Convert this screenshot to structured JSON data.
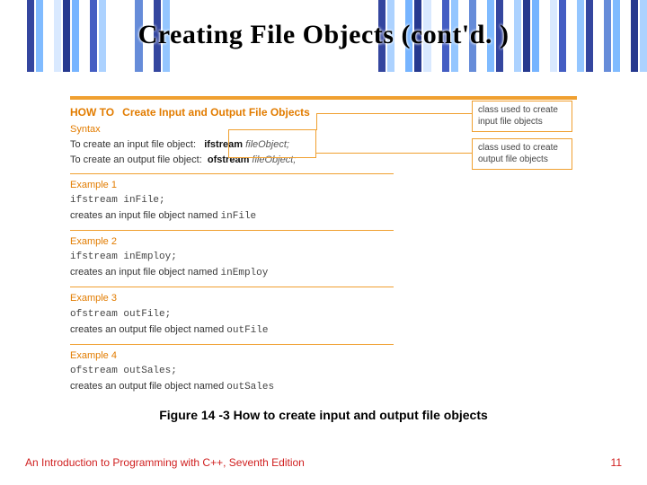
{
  "title": "Creating File Objects (cont'd. )",
  "howto": {
    "label": "HOW TO",
    "subject": "Create Input and Output File Objects",
    "syntax_label": "Syntax",
    "syntax_lines": {
      "in_prefix": "To create an input file object:",
      "in_kw": "ifstream",
      "in_obj": "fileObject;",
      "out_prefix": "To create an output file object:",
      "out_kw": "ofstream",
      "out_obj": "fileObject;"
    },
    "callouts": {
      "input": "class used to create input file objects",
      "output": "class used to create output file objects"
    },
    "examples": [
      {
        "label": "Example 1",
        "code": "ifstream inFile;",
        "desc_pre": "creates an input file object named ",
        "desc_obj": "inFile"
      },
      {
        "label": "Example 2",
        "code": "ifstream inEmploy;",
        "desc_pre": "creates an input file object named ",
        "desc_obj": "inEmploy"
      },
      {
        "label": "Example 3",
        "code": "ofstream outFile;",
        "desc_pre": "creates an output file object named ",
        "desc_obj": "outFile"
      },
      {
        "label": "Example 4",
        "code": "ofstream outSales;",
        "desc_pre": "creates an output file object named ",
        "desc_obj": "outSales"
      }
    ]
  },
  "caption": "Figure 14 -3 How to create input and output file objects",
  "footer": {
    "left": "An Introduction to Programming with C++, Seventh Edition",
    "right": "11"
  },
  "banner_colors": [
    "#ffffff",
    "#ffffff",
    "#ffffff",
    "#2a3d9a",
    "#7ab8ff",
    "#ffffff",
    "#d8e8ff",
    "#1b2f8a",
    "#6fb0ff",
    "#ffffff",
    "#3a55c0",
    "#a8d0ff",
    "#ffffff",
    "#ffffff",
    "#ffffff",
    "#5e86d8",
    "#ffffff",
    "#2a3d9a",
    "#8fc4ff",
    "#ffffff",
    "#ffffff",
    "#ffffff",
    "#ffffff",
    "#ffffff",
    "#ffffff",
    "#ffffff",
    "#ffffff",
    "#ffffff",
    "#ffffff",
    "#ffffff",
    "#ffffff",
    "#ffffff",
    "#ffffff",
    "#ffffff",
    "#ffffff",
    "#ffffff",
    "#ffffff",
    "#ffffff",
    "#ffffff",
    "#ffffff",
    "#ffffff",
    "#ffffff",
    "#2a3d9a",
    "#a8d0ff",
    "#ffffff",
    "#6fb0ff",
    "#1b2f8a",
    "#d8e8ff",
    "#ffffff",
    "#3a55c0",
    "#8fc4ff",
    "#ffffff",
    "#5e86d8",
    "#ffffff",
    "#7ab8ff",
    "#2a3d9a",
    "#ffffff",
    "#a8d0ff",
    "#1b2f8a",
    "#6fb0ff",
    "#ffffff",
    "#d8e8ff",
    "#3a55c0",
    "#ffffff",
    "#8fc4ff",
    "#2a3d9a",
    "#ffffff",
    "#5e86d8",
    "#7ab8ff",
    "#ffffff",
    "#1b2f8a",
    "#a8d0ff"
  ]
}
